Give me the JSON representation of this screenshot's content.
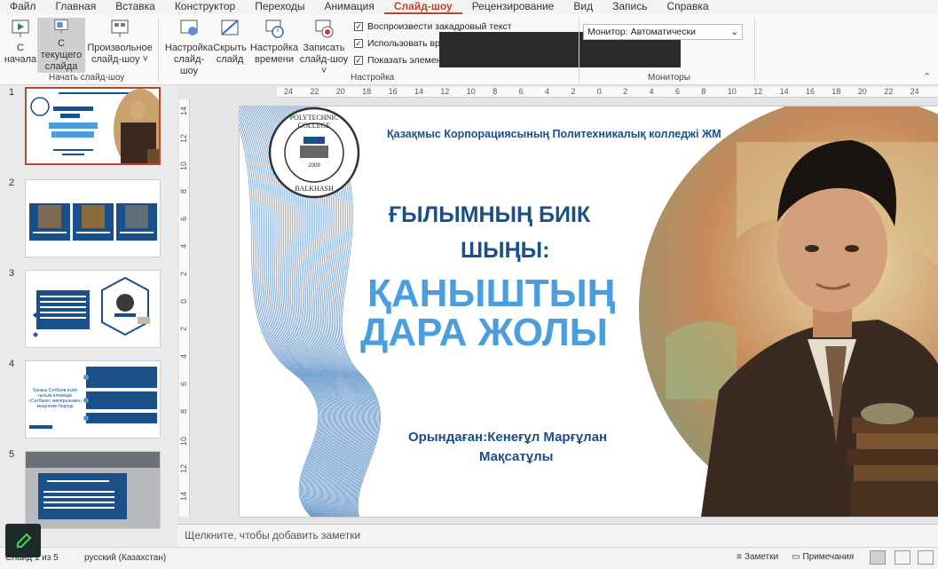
{
  "menu": [
    "Файл",
    "Главная",
    "Вставка",
    "Конструктор",
    "Переходы",
    "Анимация",
    "Слайд-шоу",
    "Рецензирование",
    "Вид",
    "Запись",
    "Справка"
  ],
  "menu_active": "Слайд-шоу",
  "ribbon": {
    "start_group": {
      "from_start": [
        "С",
        "начала"
      ],
      "from_current": [
        "С текущего",
        "слайда"
      ],
      "custom": [
        "Произвольное",
        "слайд-шоу ˅"
      ],
      "label": "Начать слайд-шоу"
    },
    "setup_group": {
      "setup": [
        "Настройка",
        "слайд-шоу"
      ],
      "hide": [
        "Скрыть",
        "слайд"
      ],
      "timing": [
        "Настройка",
        "времени"
      ],
      "record": [
        "Записать",
        "слайд-шоу ˅"
      ],
      "check1": "Воспроизвести закадровый текст",
      "check2": "Использовать вре",
      "check3": "Показать элемент",
      "label": "Настройка"
    },
    "monitors_group": {
      "monitor_label": "Монитор:",
      "monitor_value": "Автоматически",
      "label": "Мониторы"
    }
  },
  "thumbnails": [
    {
      "num": "1",
      "title": "ҒЫЛЫМНЫҢ БИІК ШЫҢЫ: ҚАНЫШТЫҢ ДАРА ЖОЛЫ"
    },
    {
      "num": "2"
    },
    {
      "num": "3"
    },
    {
      "num": "4",
      "text": "Қаныш Сәтбаев есімі ғылым әлемінде «Сәтбаев» минералымен мәңгілікке берілді"
    },
    {
      "num": "5"
    }
  ],
  "ruler_h": [
    "24",
    "22",
    "20",
    "18",
    "16",
    "14",
    "12",
    "10",
    "8",
    "6",
    "4",
    "2",
    "0",
    "2",
    "4",
    "6",
    "8",
    "10",
    "12",
    "14",
    "16",
    "18",
    "20",
    "22",
    "24"
  ],
  "ruler_v": [
    "14",
    "12",
    "10",
    "8",
    "6",
    "4",
    "2",
    "0",
    "2",
    "4",
    "6",
    "8",
    "10",
    "12",
    "14"
  ],
  "slide": {
    "college": "Қазақмыс Корпорациясының Политехникалық колледжі ЖМ",
    "logo_top": "POLYTECHNIC COLLEGE",
    "logo_bottom": "BALKHASH",
    "logo_year": "2009",
    "title1": "ҒЫЛЫМНЫҢ БИІК",
    "title2": "ШЫҢЫ:",
    "title3": "ҚАНЫШТЫҢ",
    "title4": "ДАРА ЖОЛЫ",
    "author1": "Орындаған:Кенеғұл Марғұлан",
    "author2": "Мақсатұлы"
  },
  "notes_placeholder": "Щелкните, чтобы добавить заметки",
  "status": {
    "slide_info": "Слайд 1 из 5",
    "language": "русский (Казахстан)",
    "notes_btn": "Заметки",
    "comments_btn": "Примечания"
  },
  "colors": {
    "accent": "#b7472a",
    "slide_blue_dark": "#1a4f8a",
    "slide_blue_light": "#4a9ee0"
  }
}
